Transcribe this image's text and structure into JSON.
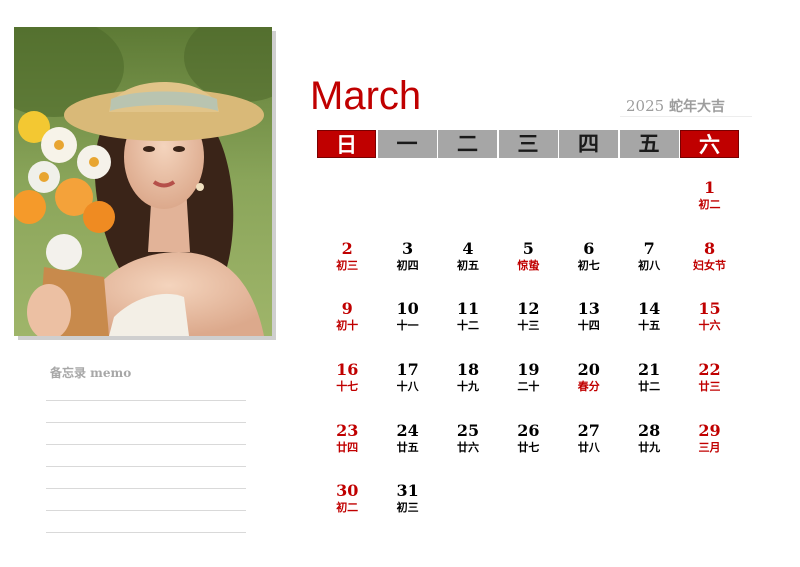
{
  "calendar": {
    "month": "March",
    "year": "2025",
    "year_text": "蛇年大吉",
    "weekdays": [
      "日",
      "一",
      "二",
      "三",
      "四",
      "五",
      "六"
    ],
    "days": [
      {
        "n": "1",
        "l": "初二"
      },
      {
        "n": "2",
        "l": "初三"
      },
      {
        "n": "3",
        "l": "初四"
      },
      {
        "n": "4",
        "l": "初五"
      },
      {
        "n": "5",
        "l": "惊蛰"
      },
      {
        "n": "6",
        "l": "初七"
      },
      {
        "n": "7",
        "l": "初八"
      },
      {
        "n": "8",
        "l": "妇女节"
      },
      {
        "n": "9",
        "l": "初十"
      },
      {
        "n": "10",
        "l": "十一"
      },
      {
        "n": "11",
        "l": "十二"
      },
      {
        "n": "12",
        "l": "十三"
      },
      {
        "n": "13",
        "l": "十四"
      },
      {
        "n": "14",
        "l": "十五"
      },
      {
        "n": "15",
        "l": "十六"
      },
      {
        "n": "16",
        "l": "十七"
      },
      {
        "n": "17",
        "l": "十八"
      },
      {
        "n": "18",
        "l": "十九"
      },
      {
        "n": "19",
        "l": "二十"
      },
      {
        "n": "20",
        "l": "春分"
      },
      {
        "n": "21",
        "l": "廿二"
      },
      {
        "n": "22",
        "l": "廿三"
      },
      {
        "n": "23",
        "l": "廿四"
      },
      {
        "n": "24",
        "l": "廿五"
      },
      {
        "n": "25",
        "l": "廿六"
      },
      {
        "n": "26",
        "l": "廿七"
      },
      {
        "n": "27",
        "l": "廿八"
      },
      {
        "n": "28",
        "l": "廿九"
      },
      {
        "n": "29",
        "l": "三月"
      },
      {
        "n": "30",
        "l": "初二"
      },
      {
        "n": "31",
        "l": "初三"
      }
    ]
  },
  "memo": {
    "label": "备忘录 memo"
  },
  "photo": {
    "icon": "portrait-photo"
  },
  "colors": {
    "accent_red": "#c00000",
    "weekday_gray": "#a6a6a6",
    "memo_gray": "#a7a7a7"
  }
}
